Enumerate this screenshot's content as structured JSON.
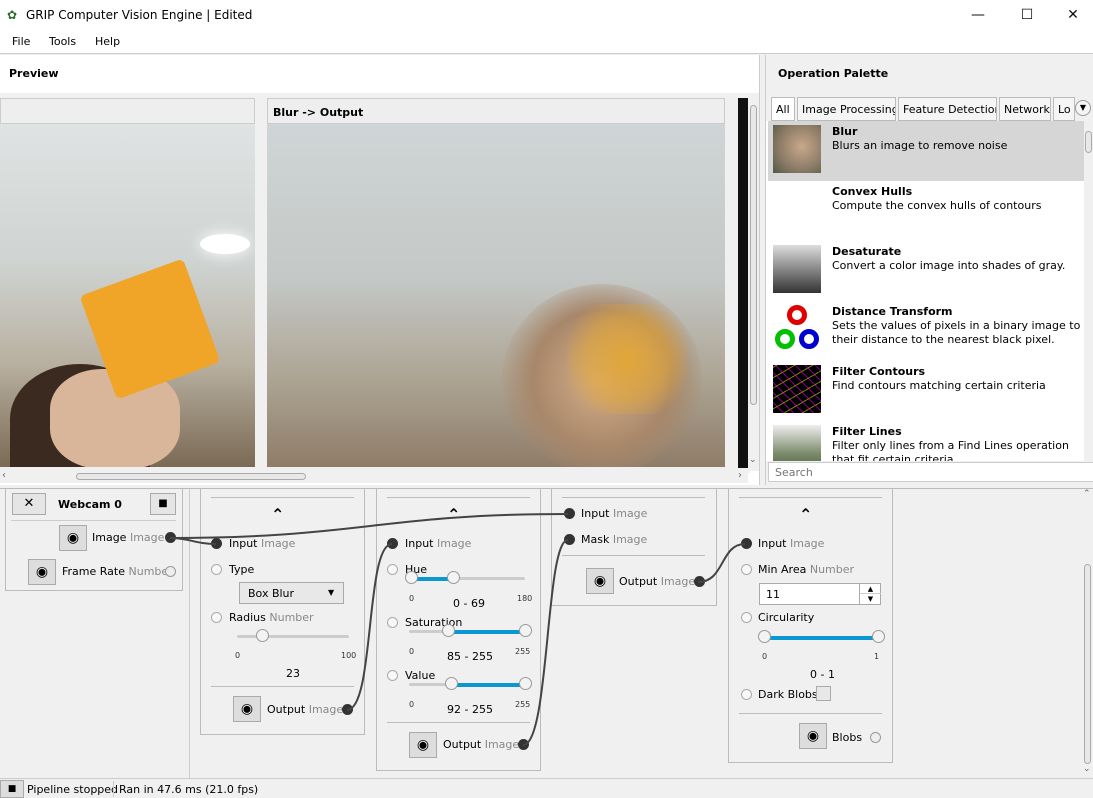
{
  "window": {
    "title": "GRIP Computer Vision Engine | Edited",
    "minimize_glyph": "—",
    "maximize_glyph": "☐",
    "close_glyph": "✕"
  },
  "menu": [
    "File",
    "Tools",
    "Help"
  ],
  "preview": {
    "title": "Preview",
    "view2_title": "Blur -> Output"
  },
  "palette": {
    "title": "Operation Palette",
    "tabs": [
      "All",
      "Image Processing",
      "Feature Detection",
      "Network",
      "Lo"
    ],
    "search_placeholder": "Search",
    "items": [
      {
        "name": "Blur",
        "desc": "Blurs an image to remove noise"
      },
      {
        "name": "Convex Hulls",
        "desc": "Compute the convex hulls of contours"
      },
      {
        "name": "Desaturate",
        "desc": "Convert a color image into shades of gray."
      },
      {
        "name": "Distance Transform",
        "desc": "Sets the values of pixels in a binary image to their distance to the nearest black pixel."
      },
      {
        "name": "Filter Contours",
        "desc": "Find contours matching certain criteria"
      },
      {
        "name": "Filter Lines",
        "desc": "Filter only lines from a Find Lines operation that fit certain criteria"
      }
    ]
  },
  "pipeline": {
    "source": {
      "name": "Webcam 0",
      "close_glyph": "✕",
      "stop_glyph": "■",
      "out1": "Image",
      "out1_type": "Image",
      "out2": "Frame Rate",
      "out2_type": "Number"
    },
    "blur": {
      "input": "Input",
      "input_type": "Image",
      "type_label": "Type",
      "type_value": "Box Blur",
      "radius_label": "Radius",
      "radius_type": "Number",
      "min": "0",
      "max": "100",
      "value": "23",
      "output": "Output",
      "output_type": "Image"
    },
    "hsv": {
      "input": "Input",
      "input_type": "Image",
      "hue": "Hue",
      "hue_min": "0",
      "hue_max": "180",
      "hue_value": "0 - 69",
      "sat": "Saturation",
      "sat_min": "0",
      "sat_max": "255",
      "sat_value": "85 - 255",
      "val": "Value",
      "val_min": "0",
      "val_max": "255",
      "val_value": "92 - 255",
      "output": "Output",
      "output_type": "Image"
    },
    "mask": {
      "input": "Input",
      "input_type": "Image",
      "mask": "Mask",
      "mask_type": "Image",
      "output": "Output",
      "output_type": "Image"
    },
    "blobs": {
      "input": "Input",
      "input_type": "Image",
      "min_area": "Min Area",
      "min_area_type": "Number",
      "min_area_value": "11",
      "circ": "Circularity",
      "circ_min": "0",
      "circ_max": "1",
      "circ_value": "0 - 1",
      "dark": "Dark Blobs",
      "output": "Blobs"
    }
  },
  "status": {
    "state": "Pipeline stopped",
    "timing": "Ran in 47.6 ms (21.0 fps)"
  }
}
